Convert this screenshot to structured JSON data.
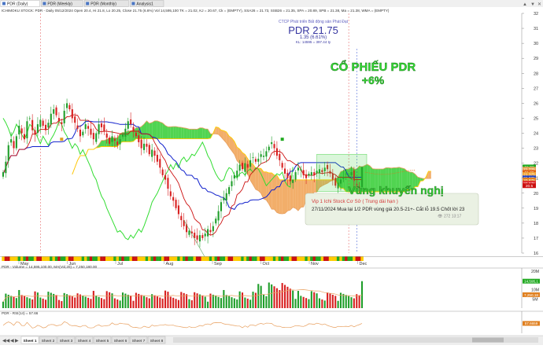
{
  "tabs": [
    {
      "label": "PDR (Daily)",
      "active": true
    },
    {
      "label": "PDR (Weekly)",
      "active": false
    },
    {
      "label": "PDR (Monthly)",
      "active": false
    },
    {
      "label": "Analysis1",
      "active": false
    }
  ],
  "header_text": "ICHIMOKU STOCK: PDR - Daily 05/12/2024 Open 20.4, Hi 21.8, Lo 20.25, Close 21.75 (6.6%) Vol 14,595,100 TK = 21.02, KJ = 20.67, Ck = (EMPTY), SSA26 = 21.73, SSB26 = 21.35, SPA = 20.89, SPB = 21.38, Ma = 21.38, WMA = (EMPTY)",
  "company_caption": "CTCP Phát triển Bất động sản Phát Đạt",
  "price_title": "PDR 21.75",
  "price_change": "1.35 (6.61%)",
  "price_volume": "KL: 14595 = 397.44 ty",
  "overlay_title_line1": "CỔ PHIẾU PDR",
  "overlay_title_line2": "+6%",
  "recommend_label": "Vùng khuyến nghị",
  "message_box": {
    "title": "Vip 1 Ichi Stock Cơ Sở ( Trung dài hạn )",
    "body": "27/11/2024 Mua lại 1/2 PDR vùng giá 20.5-21+- Cắt lỗ 19.5 Chốt lời 23",
    "meta": "272  13:17"
  },
  "volume_label": "PDR - Volume = 14,595,100.00, MA(Vol,20) = 7,250,180.00",
  "rsi_label": "PDR - RSI(14) = 57.66",
  "volume_axis_labels": [
    "20M",
    "15M",
    "10M",
    "5M"
  ],
  "volume_badges": [
    "14,595,1",
    "7,250,18"
  ],
  "rsi_badge": "57.6659",
  "sheet_tabs": [
    "Sheet 1",
    "Sheet 2",
    "Sheet 3",
    "Sheet 4",
    "Sheet 5",
    "Sheet 6",
    "Sheet 7",
    "Sheet 8"
  ],
  "price_badges": [
    {
      "label": "21.75",
      "value": 21.75,
      "color": "#22aa22"
    },
    {
      "label": "21.73",
      "value": 21.73,
      "color": "#22aa22"
    },
    {
      "label": "21.725",
      "value": 21.6,
      "color": "#e8a050"
    },
    {
      "label": "21.38",
      "value": 21.38,
      "color": "#e06010"
    },
    {
      "label": "21.375",
      "value": 21.25,
      "color": "#f0a030"
    },
    {
      "label": "21.025",
      "value": 21.02,
      "color": "#2040c0"
    },
    {
      "label": "20.875",
      "value": 20.88,
      "color": "#e08020"
    },
    {
      "label": "20.675",
      "value": 20.67,
      "color": "#e03030"
    },
    {
      "label": "20.5",
      "value": 20.5,
      "color": "#cc1010"
    }
  ],
  "colors": {
    "up": "#1f9e2a",
    "down": "#d82020",
    "tenkan": "#cc1111",
    "kijun": "#1020cc",
    "chikou": "#33dd33",
    "cloud_green": "#33cc33",
    "cloud_orange": "#f0a050",
    "ssb_line": "#ffcc00",
    "highlight": "#33cc33"
  },
  "chart_data": {
    "type": "candlestick",
    "ylim": [
      16,
      32
    ],
    "y_ticks": [
      16,
      17,
      18,
      19,
      20,
      21,
      22,
      23,
      24,
      25,
      26,
      27,
      28,
      29,
      30,
      31,
      32
    ],
    "months": [
      "May",
      "Jun",
      "Jul",
      "Aug",
      "Sep",
      "Oct",
      "Nov",
      "Dec"
    ],
    "last_close": 21.75,
    "last_change_pct": 6.61,
    "closes": [
      21.4,
      22.1,
      23.2,
      23.6,
      23.0,
      23.8,
      24.5,
      24.0,
      23.6,
      24.8,
      25.0,
      24.2,
      23.9,
      24.6,
      24.9,
      24.5,
      24.2,
      24.7,
      25.3,
      25.6,
      25.2,
      24.8,
      24.6,
      25.5,
      26.0,
      25.6,
      25.0,
      24.7,
      24.3,
      23.8,
      24.1,
      24.6,
      24.3,
      23.9,
      23.6,
      24.0,
      24.6,
      24.4,
      24.1,
      23.7,
      23.3,
      23.8,
      23.5,
      23.2,
      23.6,
      23.9,
      24.3,
      24.8,
      24.6,
      24.1,
      23.8,
      23.4,
      23.0,
      23.3,
      23.1,
      22.6,
      22.9,
      22.5,
      22.1,
      21.7,
      21.2,
      20.9,
      20.3,
      19.8,
      19.5,
      19.0,
      18.6,
      18.2,
      17.8,
      17.4,
      17.5,
      17.3,
      17.0,
      16.9,
      17.2,
      17.0,
      17.3,
      17.6,
      17.4,
      17.8,
      18.3,
      18.8,
      19.4,
      19.7,
      20.0,
      20.4,
      20.8,
      21.2,
      21.5,
      21.9,
      21.6,
      22.0,
      21.7,
      22.2,
      22.4,
      22.1,
      22.3,
      22.6,
      22.5,
      22.8,
      23.1,
      23.4,
      23.0,
      22.5,
      22.2,
      21.7,
      21.3,
      21.0,
      20.8,
      20.9,
      21.4,
      21.7,
      21.6,
      21.2,
      21.0,
      21.3,
      21.4,
      21.2,
      21.5,
      21.6,
      21.4,
      21.7,
      21.6,
      21.3,
      20.9,
      20.5,
      20.7,
      20.9,
      21.1,
      21.3,
      21.2,
      21.4,
      20.8,
      20.5,
      20.4,
      21.75
    ],
    "volume_last": 14595100,
    "volume_ma20": 7250180,
    "rsi14": 57.66
  }
}
